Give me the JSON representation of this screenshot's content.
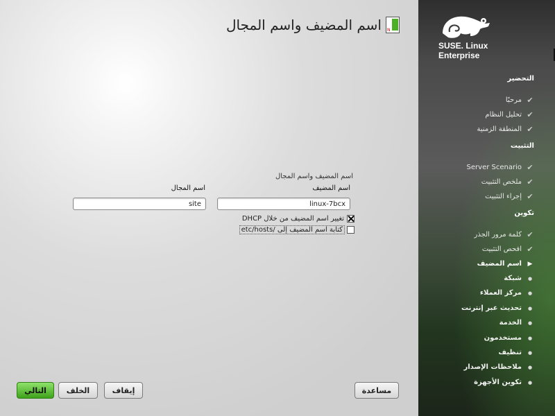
{
  "page": {
    "title": "اسم المضيف واسم المجال",
    "title_icon": "network-card-icon"
  },
  "form": {
    "frame_label": "اسم المضيف واسم المجال",
    "hostname_label": "اسم المضيف",
    "hostname_value": "linux-7bcx",
    "domain_label": "اسم المجال",
    "domain_value": "site",
    "dhcp_label": "تغيير اسم المضيف من خلال DHCP",
    "dhcp_checked": true,
    "etchosts_label": "كتابة اسم المضيف إلى /etc/hosts",
    "etchosts_checked": false
  },
  "buttons": {
    "help": "مساعدة",
    "abort": "إيقاف",
    "back": "الخلف",
    "next": "التالي"
  },
  "sidebar": {
    "logo_line1": "SUSE. Linux",
    "logo_line2": "Enterprise",
    "sections": [
      {
        "title": "التحضير",
        "steps": [
          {
            "label": "مرحبًا",
            "state": "done"
          },
          {
            "label": "تحليل النظام",
            "state": "done"
          },
          {
            "label": "المنطقة الزمنية",
            "state": "done"
          }
        ]
      },
      {
        "title": "التثبيت",
        "steps": [
          {
            "label": "Server Scenario",
            "state": "done"
          },
          {
            "label": "ملخص التثبيت",
            "state": "done"
          },
          {
            "label": "إجراء التثبيت",
            "state": "done"
          }
        ]
      },
      {
        "title": "تكوين",
        "steps": [
          {
            "label": "كلمة مرور الجذر",
            "state": "done"
          },
          {
            "label": "افحص التثبيت",
            "state": "done"
          },
          {
            "label": "اسم المضيف",
            "state": "current"
          },
          {
            "label": "شبكة",
            "state": "todo"
          },
          {
            "label": "مركز العملاء",
            "state": "todo"
          },
          {
            "label": "تحديث عبر إنترنت",
            "state": "todo"
          },
          {
            "label": "الخدمة",
            "state": "todo"
          },
          {
            "label": "مستخدمون",
            "state": "todo"
          },
          {
            "label": "تنظيف",
            "state": "todo"
          },
          {
            "label": "ملاحظات الإصدار",
            "state": "todo"
          },
          {
            "label": "تكوين الأجهزة",
            "state": "todo"
          }
        ]
      }
    ]
  },
  "colors": {
    "next_button": "#4caf25",
    "sidebar_dark": "#2e2e2e",
    "sidebar_green": "#2f5a28"
  }
}
